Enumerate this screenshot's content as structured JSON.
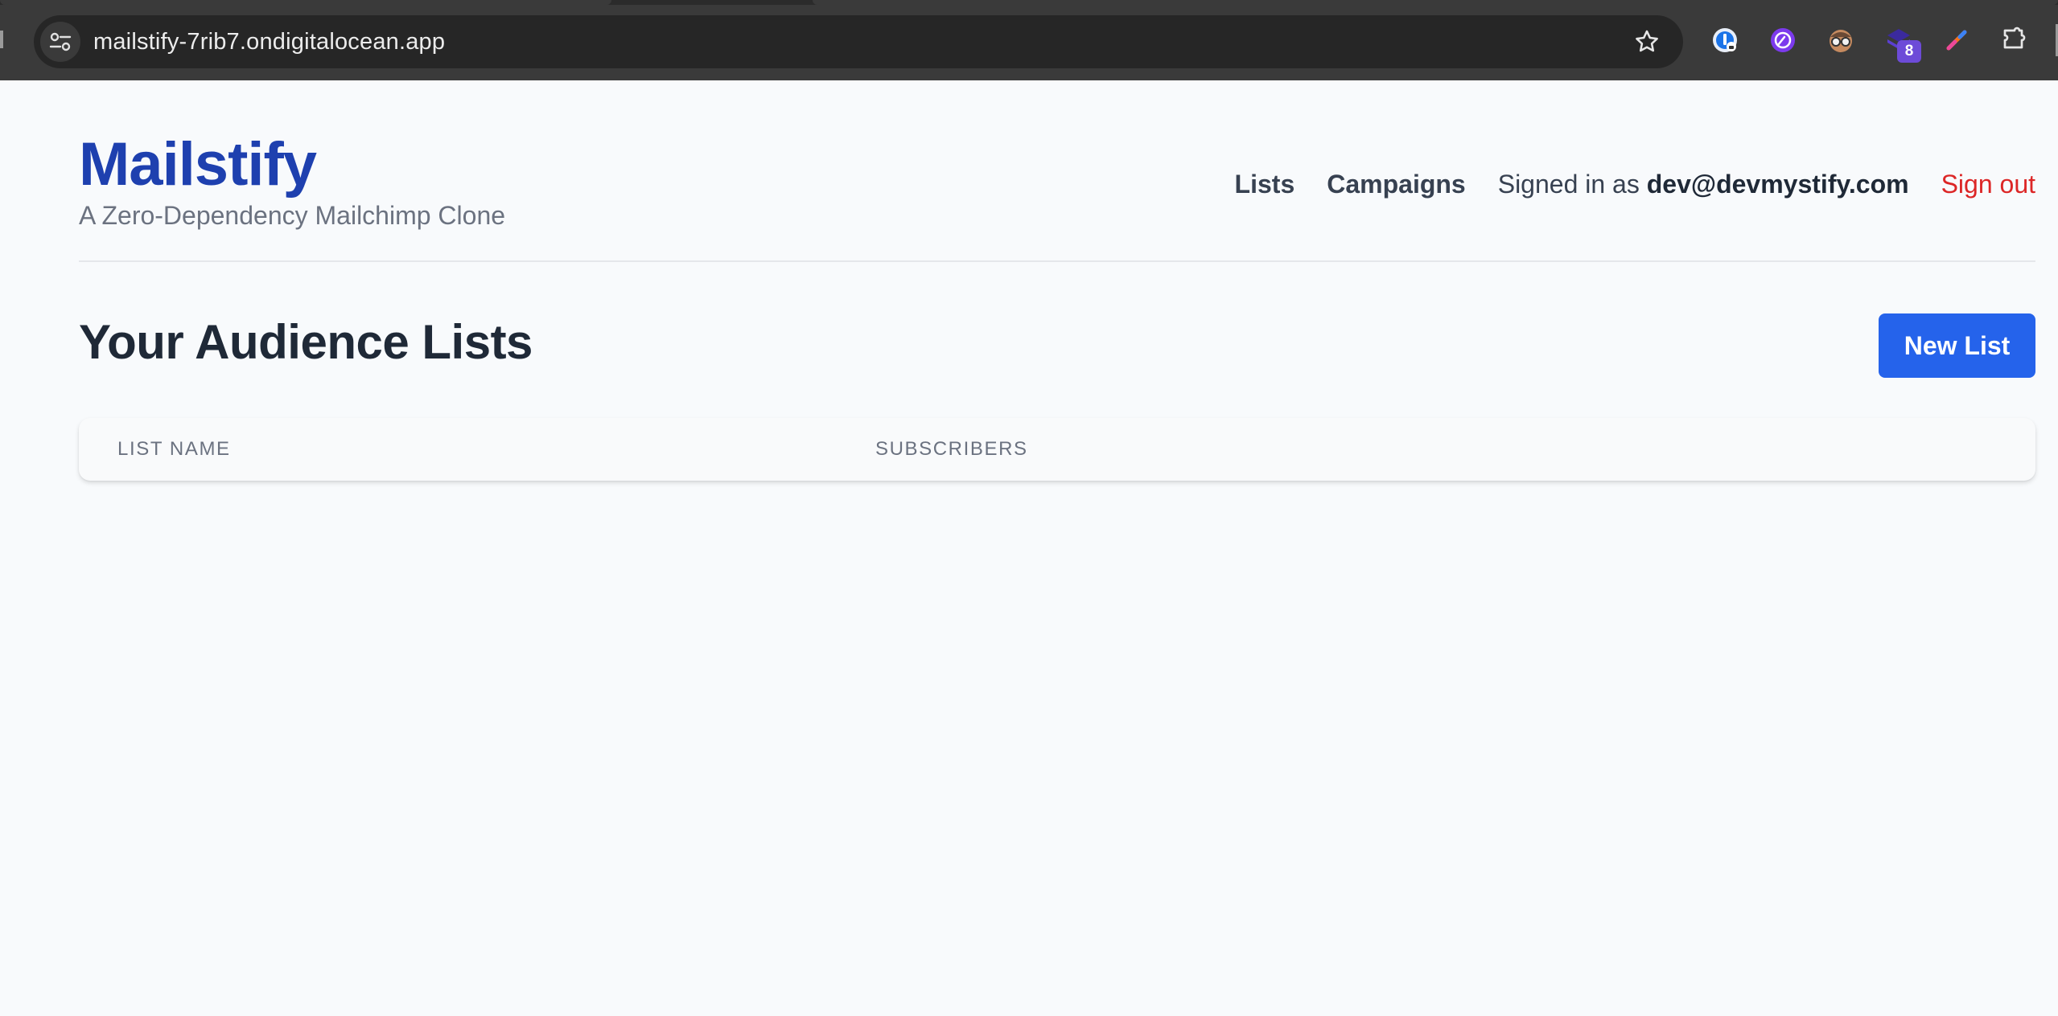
{
  "browser": {
    "url": "mailstify-7rib7.ondigitalocean.app",
    "extensions": [
      {
        "icon": "password-manager-icon"
      },
      {
        "icon": "purple-circle-extension-icon"
      },
      {
        "icon": "glasses-face-extension-icon"
      },
      {
        "icon": "stack-extension-icon",
        "badge": "8"
      },
      {
        "icon": "color-pen-extension-icon"
      },
      {
        "icon": "puzzle-piece-icon"
      }
    ],
    "colors": {
      "frame": "#3a3a3a",
      "omnibox": "#262626"
    }
  },
  "header": {
    "brand": "Mailstify",
    "tagline": "A Zero-Dependency Mailchimp Clone",
    "nav": {
      "lists": "Lists",
      "campaigns": "Campaigns",
      "signed_in_prefix": "Signed in as ",
      "user_email": "dev@devmystify.com",
      "sign_out": "Sign out"
    }
  },
  "main": {
    "title": "Your Audience Lists",
    "new_list_button": "New List",
    "table": {
      "columns": [
        "List Name",
        "Subscribers"
      ],
      "rows": []
    }
  },
  "colors": {
    "brand": "#1e40af",
    "primary_button": "#2563eb",
    "sign_out": "#dc2626",
    "page_bg": "#f8fafc"
  }
}
